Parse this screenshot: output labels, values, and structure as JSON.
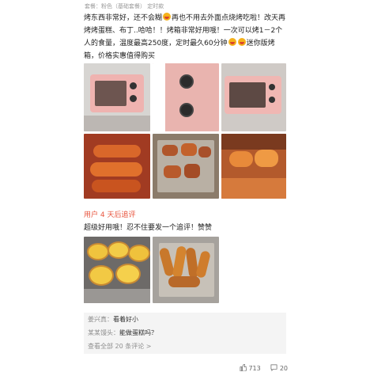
{
  "meta": {
    "line": "套餐：粉色（基础套餐）  定时款"
  },
  "review": {
    "p1": "烤东西非常好，还不会糊",
    "p2": "再也不用去外面点烧烤吃啦！改天再烤烤蛋糕、布丁..哈哈！！烤箱非常好用哦！一次可以烤1－2个人的食量，温度最高250度，定时最久60分钟",
    "p3": "迷你版烤箱，价格实惠值得购买"
  },
  "followup": {
    "title": "用户 4 天后追评",
    "text": "超级好用哦！忍不住要发一个追评！赞赞"
  },
  "comments": [
    {
      "name": "姜兴真：",
      "text": "看着好小"
    },
    {
      "name": "某某馒头：",
      "text": "能做蛋糕吗？"
    }
  ],
  "view_all": "查看全部 20 条评论 >",
  "stats": {
    "likes": "713",
    "comments": "20"
  },
  "colors": {
    "accent": "#e8543d",
    "oven_pink": "#efb3b0"
  }
}
